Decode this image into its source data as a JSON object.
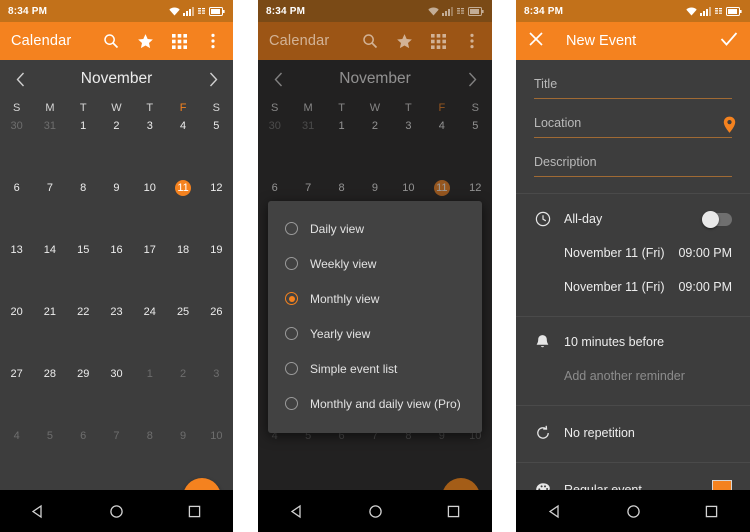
{
  "panels": {
    "calendar": {
      "status": {
        "time": "8:34 PM",
        "icons": [
          "wifi-icon",
          "signal-icon",
          "data-icon",
          "battery-icon"
        ]
      },
      "appbar": {
        "title": "Calendar",
        "actions": [
          "search-icon",
          "star-icon",
          "grid-icon",
          "overflow-menu-icon"
        ]
      },
      "month": "November",
      "prev": "‹",
      "next": "›",
      "day_headers": [
        "S",
        "M",
        "T",
        "W",
        "T",
        "F",
        "S"
      ],
      "selected_day_header_index": 5,
      "weeks": [
        [
          {
            "d": "30",
            "out": true
          },
          {
            "d": "31",
            "out": true
          },
          {
            "d": "1"
          },
          {
            "d": "2"
          },
          {
            "d": "3"
          },
          {
            "d": "4"
          },
          {
            "d": "5"
          }
        ],
        [
          {
            "d": "6"
          },
          {
            "d": "7"
          },
          {
            "d": "8"
          },
          {
            "d": "9"
          },
          {
            "d": "10"
          },
          {
            "d": "11",
            "today": true
          },
          {
            "d": "12"
          }
        ],
        [
          {
            "d": "13"
          },
          {
            "d": "14"
          },
          {
            "d": "15"
          },
          {
            "d": "16"
          },
          {
            "d": "17"
          },
          {
            "d": "18"
          },
          {
            "d": "19"
          }
        ],
        [
          {
            "d": "20"
          },
          {
            "d": "21"
          },
          {
            "d": "22"
          },
          {
            "d": "23"
          },
          {
            "d": "24"
          },
          {
            "d": "25"
          },
          {
            "d": "26"
          }
        ],
        [
          {
            "d": "27"
          },
          {
            "d": "28"
          },
          {
            "d": "29"
          },
          {
            "d": "30"
          },
          {
            "d": "1",
            "out": true
          },
          {
            "d": "2",
            "out": true
          },
          {
            "d": "3",
            "out": true
          }
        ],
        [
          {
            "d": "4",
            "out": true
          },
          {
            "d": "5",
            "out": true
          },
          {
            "d": "6",
            "out": true
          },
          {
            "d": "7",
            "out": true
          },
          {
            "d": "8",
            "out": true
          },
          {
            "d": "9",
            "out": true
          },
          {
            "d": "10",
            "out": true
          }
        ]
      ],
      "fab_label": "+"
    },
    "view_picker": {
      "options": [
        {
          "label": "Daily view",
          "selected": false
        },
        {
          "label": "Weekly view",
          "selected": false
        },
        {
          "label": "Monthly view",
          "selected": true
        },
        {
          "label": "Yearly view",
          "selected": false
        },
        {
          "label": "Simple event list",
          "selected": false
        },
        {
          "label": "Monthly and daily view (Pro)",
          "selected": false
        }
      ]
    },
    "new_event": {
      "status": {
        "time": "8:34 PM"
      },
      "appbar": {
        "title": "New Event",
        "close": "close-icon",
        "confirm": "check-icon"
      },
      "fields": {
        "title_placeholder": "Title",
        "location_placeholder": "Location",
        "description_placeholder": "Description"
      },
      "allday": {
        "label": "All-day",
        "on": false
      },
      "start": {
        "date": "November 11 (Fri)",
        "time": "09:00 PM"
      },
      "end": {
        "date": "November 11 (Fri)",
        "time": "09:00 PM"
      },
      "reminder": {
        "label": "10 minutes before",
        "add_label": "Add another reminder"
      },
      "repetition": {
        "label": "No repetition"
      },
      "event_type": {
        "label": "Regular event",
        "color": "#f4821f"
      }
    }
  },
  "navbar": {
    "back": "back-triangle-icon",
    "home": "home-circle-icon",
    "recents": "recents-square-icon"
  },
  "colors": {
    "accent": "#f4821f",
    "bg": "#3d3d3d",
    "statusbar": "#c2711a"
  }
}
